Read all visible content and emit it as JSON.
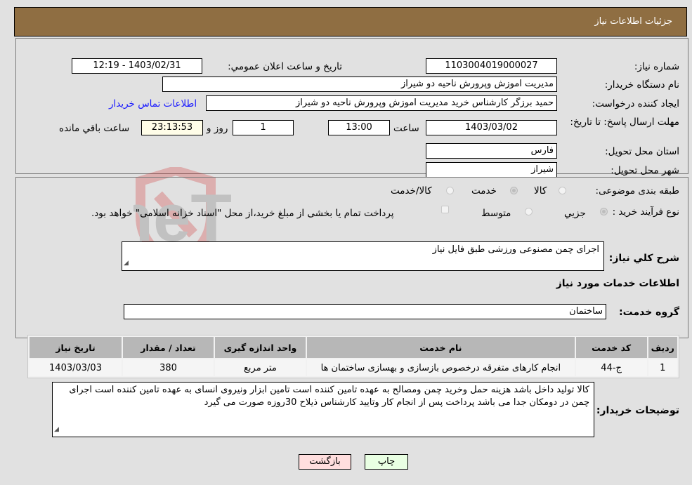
{
  "header": {
    "title": "جزئيات اطلاعات نياز"
  },
  "fields": {
    "need_number_label": "شماره نياز:",
    "need_number": "1103004019000027",
    "announce_label": "تاريخ و ساعت اعلان عمومي:",
    "announce_value": "1403/02/31 - 12:19",
    "buyer_org_label": "نام دستگاه خريدار:",
    "buyer_org": "مديريت اموزش وپرورش ناحيه دو شيراز",
    "creator_label": "ايجاد كننده درخواست:",
    "creator": "حميد برزگر كارشناس خريد مديريت اموزش وپرورش ناحيه دو شيراز",
    "contact_link": "اطلاعات تماس خريدار",
    "deadline_label": "مهلت ارسال پاسخ: تا تاريخ:",
    "deadline_date": "1403/03/02",
    "time_label": "ساعت",
    "deadline_time": "13:00",
    "days_value": "1",
    "days_label": "روز و",
    "remaining_time": "23:13:53",
    "remaining_label": "ساعت باقي مانده",
    "province_label": "استان محل تحويل:",
    "province": "فارس",
    "city_label": "شهر محل تحويل:",
    "city": "شيراز",
    "category_label": "طبقه بندی موضوعی:",
    "category_options": [
      "كالا",
      "خدمت",
      "كالا/خدمت"
    ],
    "category_selected": "خدمت",
    "process_label": "نوع فرآيند خريد :",
    "process_options": [
      "جزيي",
      "متوسط"
    ],
    "process_selected": "جزيي",
    "treasury_note": "پرداخت تمام يا بخشی از مبلغ خريد،از محل \"اسناد خزانه اسلامی\" خواهد بود."
  },
  "details": {
    "summary_label": "شرح كلي نياز:",
    "summary": "اجرای چمن مصنوعی ورزشی طبق فایل نیاز",
    "services_heading": "اطلاعات خدمات مورد نياز",
    "service_group_label": "گروه خدمت:",
    "service_group": "ساختمان",
    "table": {
      "headers": [
        "رديف",
        "كد خدمت",
        "نام خدمت",
        "واحد اندازه گيری",
        "تعداد / مقدار",
        "تاريخ نياز"
      ],
      "rows": [
        [
          "1",
          "ج-44",
          "انجام كارهای متفرقه درخصوص بازسازی و بهسازی ساختمان ها",
          "متر مربع",
          "380",
          "1403/03/03"
        ]
      ]
    },
    "buyer_notes_label": "توضيحات خريدار:",
    "buyer_notes": "کالا تولید داخل باشد هزینه حمل وخرید چمن ومصالح به عهده تامین کننده است تامین ابزار ونیروی انسای به عهده تامین کننده است اجرای چمن در دومکان جدا می باشد پرداخت پس از انجام کار وتایید کارشناس ذیلاح 30روزه صورت می گیرد"
  },
  "buttons": {
    "print": "چاپ",
    "back": "بازگشت"
  },
  "watermark": {
    "text": "AriaTender.neT"
  }
}
